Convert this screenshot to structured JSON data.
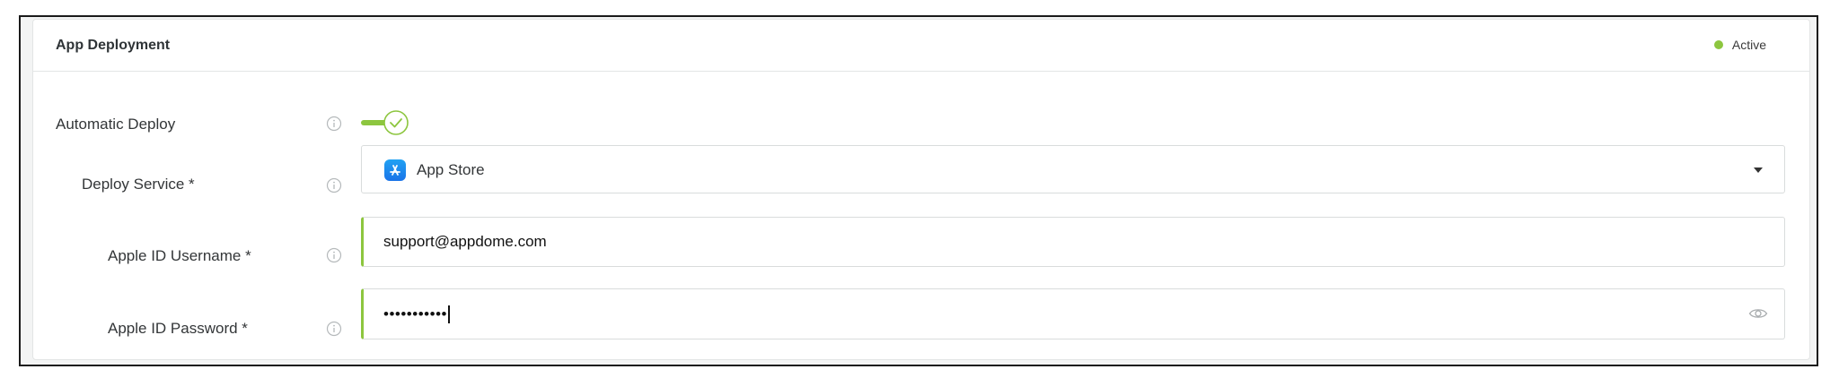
{
  "card": {
    "title": "App Deployment",
    "status_label": "Active",
    "status_color": "#8dc63f"
  },
  "automatic_deploy": {
    "label": "Automatic Deploy",
    "enabled": true
  },
  "deploy_service": {
    "label": "Deploy Service *",
    "selected_value": "App Store",
    "icon": "app-store-icon"
  },
  "apple_id_username": {
    "label": "Apple ID Username *",
    "value": "support@appdome.com"
  },
  "apple_id_password": {
    "label": "Apple ID Password *",
    "masked_value": "•••••••••••",
    "toggle_icon": "eye-icon"
  },
  "colors": {
    "accent": "#8dc63f",
    "border": "#d9dcdc",
    "frame_background": "#f3f4f4"
  }
}
